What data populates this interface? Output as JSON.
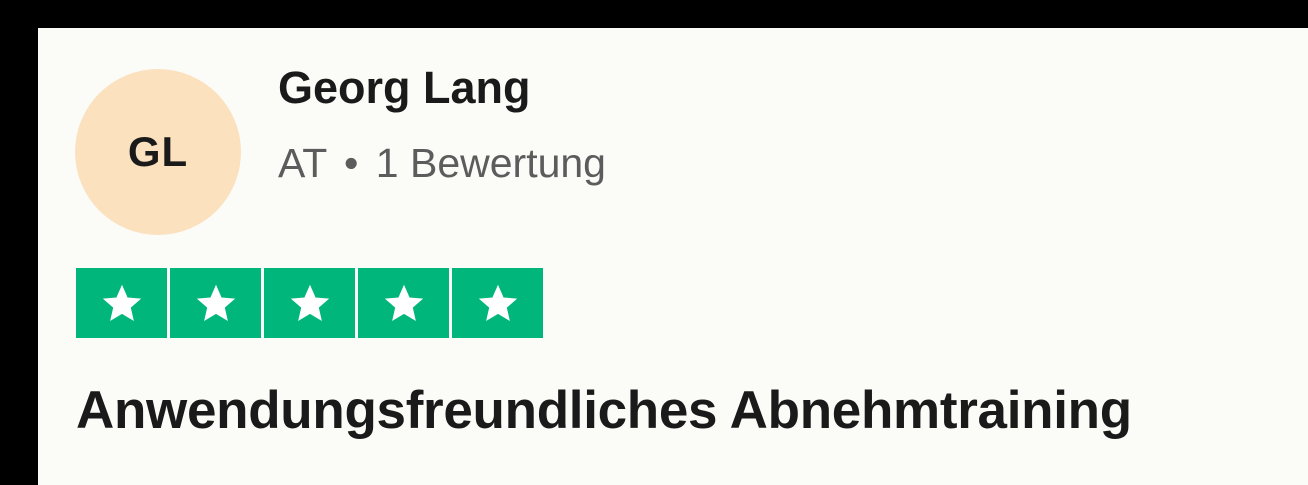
{
  "reviewer": {
    "initials": "GL",
    "name": "Georg Lang",
    "country": "AT",
    "separator": "•",
    "review_count_label": "1 Bewertung"
  },
  "rating": {
    "stars": 5,
    "max": 5,
    "color": "#00b67a"
  },
  "review": {
    "title": "Anwendungsfreundliches Abnehmtraining"
  },
  "colors": {
    "avatar_bg": "#fce1bf",
    "card_bg": "#fbfbf8",
    "meta_text": "#5c5c5c"
  },
  "icons": [
    "star-icon"
  ]
}
